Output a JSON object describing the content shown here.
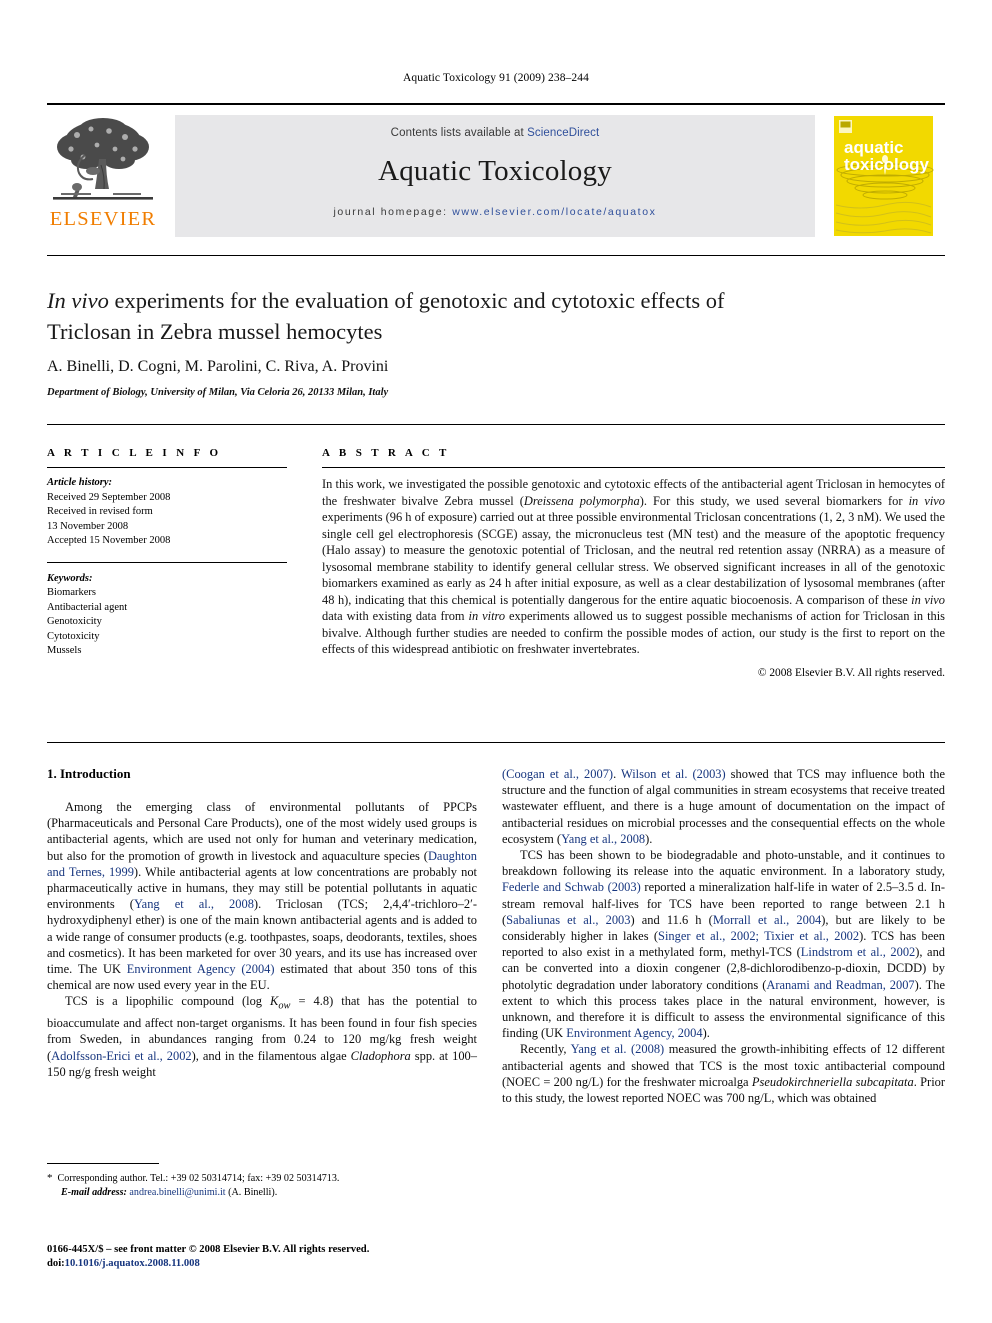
{
  "running_head": "Aquatic Toxicology 91 (2009) 238–244",
  "masthead": {
    "publisher_logo_label": "ELSEVIER",
    "contents_prefix": "Contents lists available at ",
    "contents_link": "ScienceDirect",
    "journal_title": "Aquatic Toxicology",
    "homepage_prefix": "journal homepage:",
    "homepage_url": "www.elsevier.com/locate/aquatox",
    "cover_line1": "aquatic",
    "cover_line2": "toxicology"
  },
  "title": {
    "italic_lead": "In vivo",
    "rest_line1": " experiments for the evaluation of genotoxic and cytotoxic effects of",
    "line2": "Triclosan in Zebra mussel hemocytes"
  },
  "authors": "A. Binelli, D. Cogni, M. Parolini, C. Riva, A. Provini",
  "affiliation": "Department of Biology, University of Milan, Via Celoria 26, 20133 Milan, Italy",
  "article_info": {
    "heading": "A R T I C L E    I N F O",
    "history_heading": "Article history:",
    "history_lines": [
      "Received 29 September 2008",
      "Received in revised form",
      "13 November 2008",
      "Accepted 15 November 2008"
    ],
    "keywords_heading": "Keywords:",
    "keywords": [
      "Biomarkers",
      "Antibacterial agent",
      "Genotoxicity",
      "Cytotoxicity",
      "Mussels"
    ]
  },
  "abstract": {
    "heading": "A B S T R A C T",
    "p1_a": "In this work, we investigated the possible genotoxic and cytotoxic effects of the antibacterial agent Triclosan in hemocytes of the freshwater bivalve Zebra mussel (",
    "p1_sp": "Dreissena polymorpha",
    "p1_b": "). For this study, we used several biomarkers for ",
    "p1_iv": "in vivo",
    "p1_c": " experiments (96 h of exposure) carried out at three possible environmental Triclosan concentrations (1, 2, 3 nM). We used the single cell gel electrophoresis (SCGE) assay, the micronucleus test (MN test) and the measure of the apoptotic frequency (Halo assay) to measure the genotoxic potential of Triclosan, and the neutral red retention assay (NRRA) as a measure of lysosomal membrane stability to identify general cellular stress. We observed significant increases in all of the genotoxic biomarkers examined as early as 24 h after initial exposure, as well as a clear destabilization of lysosomal membranes (after 48 h), indicating that this chemical is potentially dangerous for the entire aquatic biocoenosis. A comparison of these ",
    "p1_iv2": "in vivo",
    "p1_d": " data with existing data from ",
    "p1_iv3": "in vitro",
    "p1_e": " experiments allowed us to suggest possible mechanisms of action for Triclosan in this bivalve. Although further studies are needed to confirm the possible modes of action, our study is the first to report on the effects of this widespread antibiotic on freshwater invertebrates.",
    "copyright": "© 2008 Elsevier B.V. All rights reserved."
  },
  "body": {
    "section_heading": "1.  Introduction",
    "left": {
      "p1": {
        "t1": "Among the emerging class of environmental pollutants of PPCPs (Pharmaceuticals and Personal Care Products), one of the most widely used groups is antibacterial agents, which are used not only for human and veterinary medication, but also for the promotion of growth in livestock and aquaculture species (",
        "c1": "Daughton and Ternes, 1999",
        "t2": "). While antibacterial agents at low concentrations are probably not pharmaceutically active in humans, they may still be potential pollutants in aquatic environments (",
        "c2": "Yang et al., 2008",
        "t3": "). Triclosan (TCS; 2,4,4′-trichloro–2′-hydroxydiphenyl ether) is one of the main known antibacterial agents and is added to a wide range of consumer products (e.g. toothpastes, soaps, deodorants, textiles, shoes and cosmetics). It has been marketed for over 30 years, and its use has increased over time. The UK ",
        "c3": "Environment Agency (2004)",
        "t4": " estimated that about 350 tons of this chemical are now used every year in the EU."
      },
      "p2": {
        "t1": "TCS is a lipophilic compound (log ",
        "k": "K",
        "ow": "ow",
        "t2": " = 4.8) that has the potential to bioaccumulate and affect non-target organisms. It has been found in four fish species from Sweden, in abundances ranging from 0.24 to 120 mg/kg fresh weight (",
        "c1": "Adolfsson-Erici et al., 2002",
        "t3": "), and in the filamentous algae ",
        "sp": "Cladophora",
        "t4": " spp. at 100–150 ng/g fresh weight"
      }
    },
    "right": {
      "p1": {
        "c0": "(Coogan et al., 2007)",
        "t0": ". ",
        "c1": "Wilson et al. (2003)",
        "t1": " showed that TCS may influence both the structure and the function of algal communities in stream ecosystems that receive treated wastewater effluent, and there is a huge amount of documentation on the impact of antibacterial residues on microbial processes and the consequential effects on the whole ecosystem (",
        "c2": "Yang et al., 2008",
        "t2": ")."
      },
      "p2": {
        "t1": "TCS has been shown to be biodegradable and photo-unstable, and it continues to breakdown following its release into the aquatic environment. In a laboratory study, ",
        "c1": "Federle and Schwab (2003)",
        "t2": " reported a mineralization half-life in water of 2.5–3.5 d. In-stream removal half-lives for TCS have been reported to range between 2.1 h (",
        "c2": "Sabaliunas et al., 2003",
        "t3": ") and 11.6 h (",
        "c3": "Morrall et al., 2004",
        "t4": "), but are likely to be considerably higher in lakes (",
        "c4": "Singer et al., 2002; Tixier et al., 2002",
        "t5": "). TCS has been reported to also exist in a methylated form, methyl-TCS (",
        "c5": "Lindstrom et al., 2002",
        "t6": "), and can be converted into a dioxin congener (2,8-dichlorodibenzo-p-dioxin, DCDD) by photolytic degradation under laboratory conditions (",
        "c6": "Aranami and Readman, 2007",
        "t7": "). The extent to which this process takes place in the natural environment, however, is unknown, and therefore it is difficult to assess the environmental significance of this finding (UK ",
        "c7": "Environment Agency, 2004",
        "t8": ")."
      },
      "p3": {
        "t1": "Recently, ",
        "c1": "Yang et al. (2008)",
        "t2": " measured the growth-inhibiting effects of 12 different antibacterial agents and showed that TCS is the most toxic antibacterial compound (NOEC = 200 ng/L) for the freshwater microalga ",
        "sp": "Pseudokirchneriella subcapitata",
        "t3": ". Prior to this study, the lowest reported NOEC was 700 ng/L, which was obtained"
      }
    }
  },
  "footnote": {
    "star": "*",
    "corresponding": "Corresponding author. Tel.: +39 02 50314714; fax: +39 02 50314713.",
    "email_label": "E-mail address:",
    "email": "andrea.binelli@unimi.it",
    "email_suffix": "(A. Binelli)."
  },
  "issn_line": "0166-445X/$ – see front matter © 2008 Elsevier B.V. All rights reserved.",
  "doi_label": "doi:",
  "doi_value": "10.1016/j.aquatox.2008.11.008",
  "colors": {
    "link_blue": "#2f4f9b",
    "cite_blue": "#17367f",
    "elsevier_orange": "#f07d00",
    "band_gray": "#e7e7e9",
    "cover_yellow": "#f2d900"
  }
}
